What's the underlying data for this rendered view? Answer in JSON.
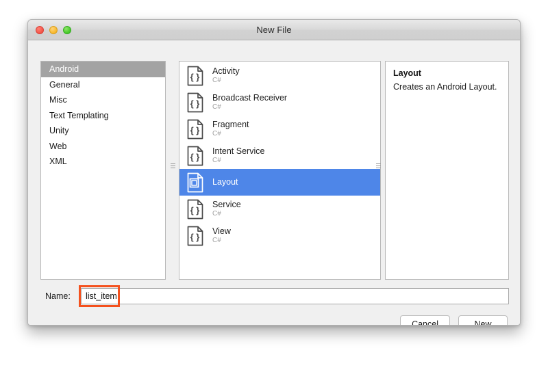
{
  "window": {
    "title": "New File",
    "traffic_lights": [
      {
        "name": "close",
        "color": "#f5584c"
      },
      {
        "name": "minimize",
        "color": "#f9bb33"
      },
      {
        "name": "maximize",
        "color": "#4ccb2d"
      }
    ]
  },
  "categories": {
    "items": [
      {
        "label": "Android",
        "selected": true
      },
      {
        "label": "General",
        "selected": false
      },
      {
        "label": "Misc",
        "selected": false
      },
      {
        "label": "Text Templating",
        "selected": false
      },
      {
        "label": "Unity",
        "selected": false
      },
      {
        "label": "Web",
        "selected": false
      },
      {
        "label": "XML",
        "selected": false
      }
    ],
    "selected_color": "#a3a3a3"
  },
  "templates": {
    "items": [
      {
        "title": "Activity",
        "subtitle": "C#",
        "icon": "csharp-file-icon",
        "selected": false
      },
      {
        "title": "Broadcast Receiver",
        "subtitle": "C#",
        "icon": "csharp-file-icon",
        "selected": false
      },
      {
        "title": "Fragment",
        "subtitle": "C#",
        "icon": "csharp-file-icon",
        "selected": false
      },
      {
        "title": "Intent Service",
        "subtitle": "C#",
        "icon": "csharp-file-icon",
        "selected": false
      },
      {
        "title": "Layout",
        "subtitle": "",
        "icon": "layout-file-icon",
        "selected": true
      },
      {
        "title": "Service",
        "subtitle": "C#",
        "icon": "csharp-file-icon",
        "selected": false
      },
      {
        "title": "View",
        "subtitle": "C#",
        "icon": "csharp-file-icon",
        "selected": false
      }
    ],
    "selection_color": "#4e86e8"
  },
  "details": {
    "title": "Layout",
    "description": "Creates an Android Layout."
  },
  "name_field": {
    "label": "Name:",
    "value": "list_item",
    "placeholder": "",
    "annotation_color": "#f4511e"
  },
  "buttons": {
    "cancel": "Cancel",
    "confirm": "New"
  }
}
